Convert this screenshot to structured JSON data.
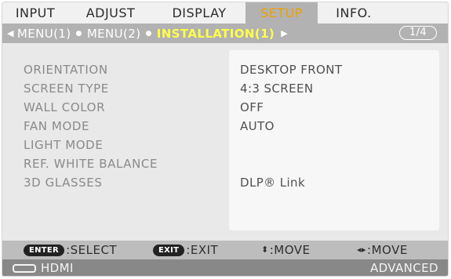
{
  "tabs": [
    "INPUT",
    "ADJUST",
    "DISPLAY",
    "SETUP",
    "INFO."
  ],
  "active_tab": "SETUP",
  "submenu": {
    "items": [
      "MENU(1)",
      "MENU(2)",
      "INSTALLATION(1)"
    ],
    "active": "INSTALLATION(1)",
    "page": "1/4"
  },
  "settings": [
    {
      "label": "ORIENTATION",
      "value": "DESKTOP FRONT"
    },
    {
      "label": "SCREEN TYPE",
      "value": "4:3 SCREEN"
    },
    {
      "label": "WALL COLOR",
      "value": "OFF"
    },
    {
      "label": "FAN MODE",
      "value": "AUTO"
    },
    {
      "label": "LIGHT MODE",
      "value": ""
    },
    {
      "label": "REF. WHITE BALANCE",
      "value": ""
    },
    {
      "label": "3D GLASSES",
      "value": "DLP® Link"
    }
  ],
  "keybar": {
    "enter_key": "ENTER",
    "enter_action": ":SELECT",
    "exit_key": "EXIT",
    "exit_action": ":EXIT",
    "updown_action": ":MOVE",
    "leftright_action": ":MOVE"
  },
  "status": {
    "input": "HDMI",
    "mode": "ADVANCED"
  },
  "colors": {
    "active_tab_text": "#f0a000",
    "active_submenu_text": "#ffff4a",
    "bar_gray": "#b2b2b2"
  }
}
